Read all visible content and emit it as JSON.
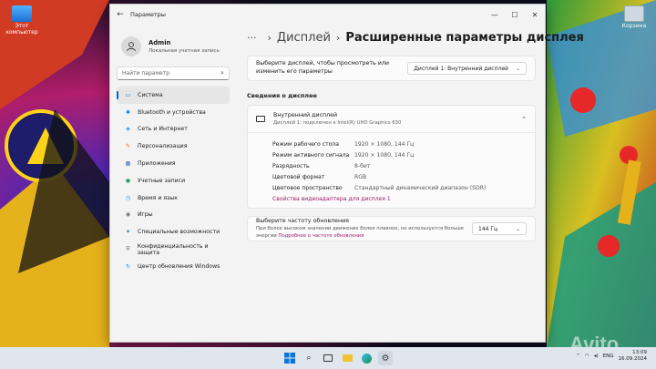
{
  "desktop": {
    "icons": [
      {
        "label": "Этот\nкомпьютер"
      },
      {
        "label": "Корзина"
      }
    ]
  },
  "window": {
    "title": "Параметры",
    "controls": {
      "minimize": "—",
      "maximize": "☐",
      "close": "✕"
    }
  },
  "user": {
    "name": "Admin",
    "account_type": "Локальная учетная запись"
  },
  "search": {
    "placeholder": "Найти параметр"
  },
  "nav": {
    "items": [
      {
        "label": "Система",
        "icon": "system-icon",
        "color": "#0067c0"
      },
      {
        "label": "Bluetooth и устройства",
        "icon": "bluetooth-icon",
        "color": "#0a79d8"
      },
      {
        "label": "Сеть и Интернет",
        "icon": "network-icon",
        "color": "#1a86d9"
      },
      {
        "label": "Персонализация",
        "icon": "brush-icon",
        "color": "#e0642f"
      },
      {
        "label": "Приложения",
        "icon": "apps-icon",
        "color": "#3a6fb5"
      },
      {
        "label": "Учетные записи",
        "icon": "accounts-icon",
        "color": "#2ea36b"
      },
      {
        "label": "Время и язык",
        "icon": "globe-time-icon",
        "color": "#1a86d9"
      },
      {
        "label": "Игры",
        "icon": "games-icon",
        "color": "#6b6b6b"
      },
      {
        "label": "Специальные возможности",
        "icon": "accessibility-icon",
        "color": "#1a6fbf"
      },
      {
        "label": "Конфиденциальность и защита",
        "icon": "shield-icon",
        "color": "#6b6b6b"
      },
      {
        "label": "Центр обновления Windows",
        "icon": "update-icon",
        "color": "#1a86d9"
      }
    ]
  },
  "breadcrumb": {
    "dots": "···",
    "parent": "Дисплей",
    "current": "Расширенные параметры дисплея"
  },
  "display_select": {
    "label": "Выберите дисплей, чтобы просмотреть или изменить его параметры",
    "value": "Дисплей 1: Внутренний дисплей"
  },
  "info": {
    "heading": "Сведения о дисплее",
    "title": "Внутренний дисплей",
    "subtitle": "Дисплей 1: подключен к Intel(R) UHD Graphics 630",
    "rows": [
      {
        "key": "Режим рабочего стола",
        "value": "1920 × 1080, 144 Гц"
      },
      {
        "key": "Режим активного сигнала",
        "value": "1920 × 1080, 144 Гц"
      },
      {
        "key": "Разрядность",
        "value": "8-бит"
      },
      {
        "key": "Цветовой формат",
        "value": "RGB"
      },
      {
        "key": "Цветовое пространство",
        "value": "Стандартный динамический диапазон (SDR)"
      }
    ],
    "adapter_link": "Свойства видеоадаптера для дисплея 1"
  },
  "refresh": {
    "title": "Выберите частоту обновления",
    "desc": "При более высоком значении движение более плавное, но используется больше энергии",
    "link": "Подробнее о частоте обновления",
    "value": "144 Гц"
  },
  "taskbar": {
    "lang": "ENG",
    "time": "13:09",
    "date": "16.09.2024"
  }
}
